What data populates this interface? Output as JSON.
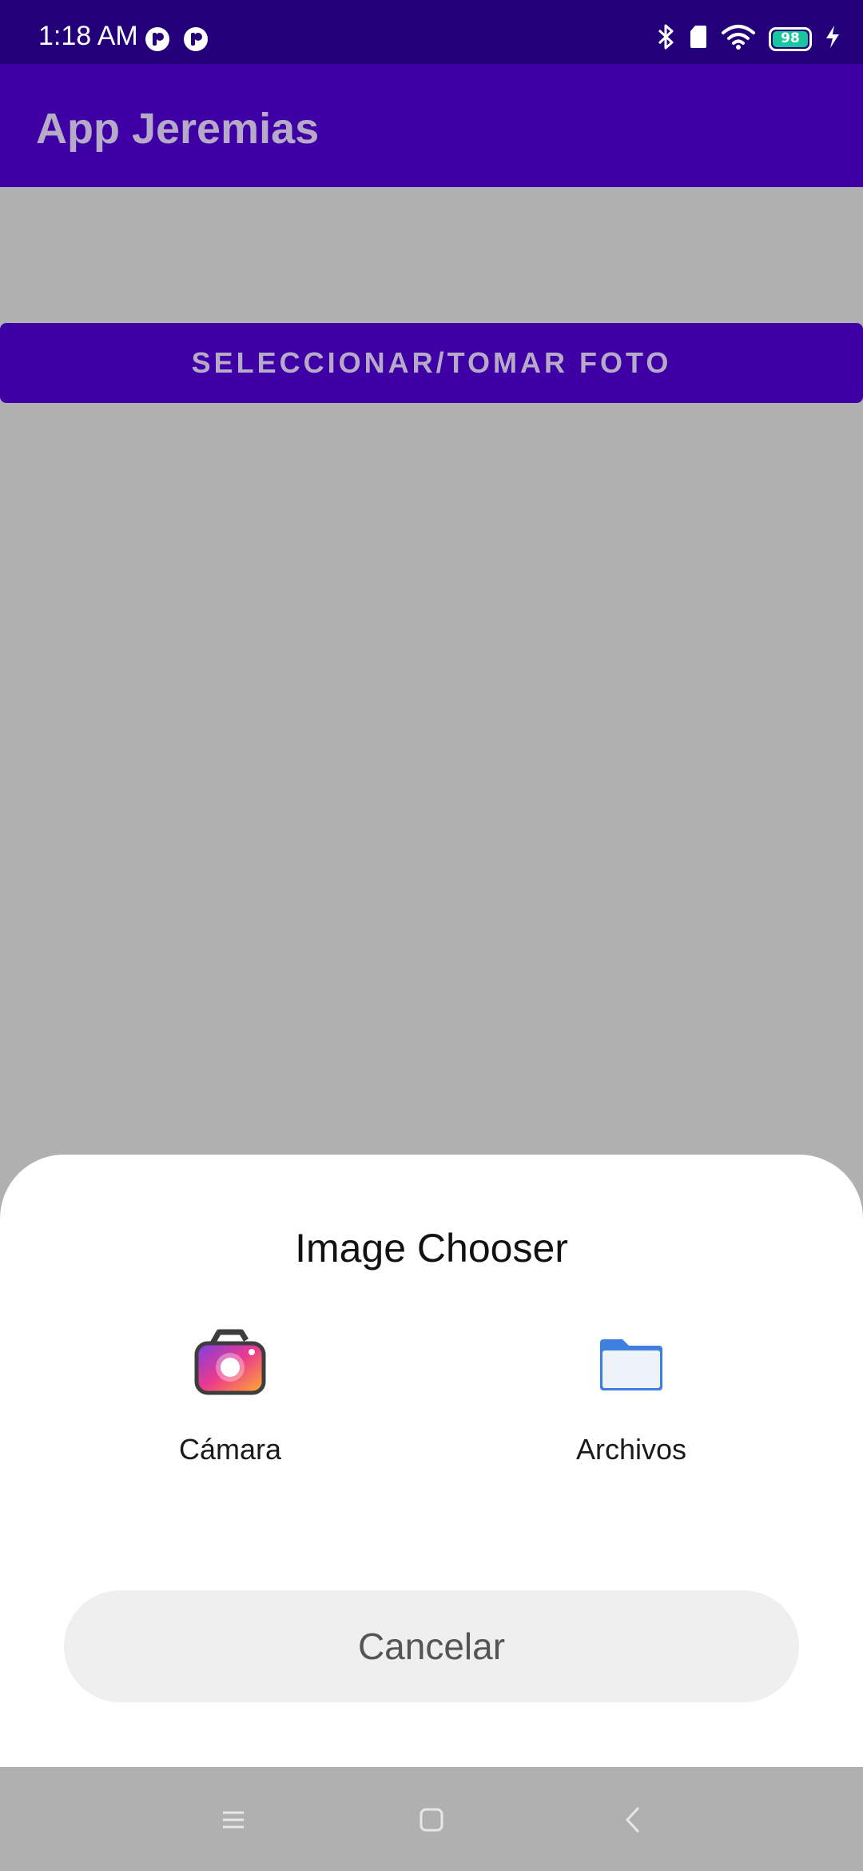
{
  "status_bar": {
    "time": "1:18 AM",
    "battery_level": "98",
    "left_icons": [
      "notification-icon",
      "notification-icon"
    ],
    "right_icons": [
      "bluetooth-icon",
      "sim-icon",
      "wifi-icon",
      "battery-icon",
      "charging-icon"
    ]
  },
  "app_bar": {
    "title": "App Jeremias"
  },
  "main": {
    "button_label": "SELECCIONAR/TOMAR FOTO"
  },
  "chooser": {
    "title": "Image Chooser",
    "options": [
      {
        "label": "Cámara",
        "icon": "camera-icon"
      },
      {
        "label": "Archivos",
        "icon": "folder-icon"
      }
    ],
    "cancel_label": "Cancelar"
  },
  "nav_bar": {
    "buttons": [
      "menu-icon",
      "home-icon",
      "back-icon"
    ]
  },
  "colors": {
    "status_bar": "#23007a",
    "primary": "#3e00a4",
    "on_primary_dimmed": "#b7aac9",
    "scrim_background": "#b0b0b0",
    "sheet": "#ffffff",
    "cancel_button": "#efefef",
    "battery": "#19c6a0"
  }
}
